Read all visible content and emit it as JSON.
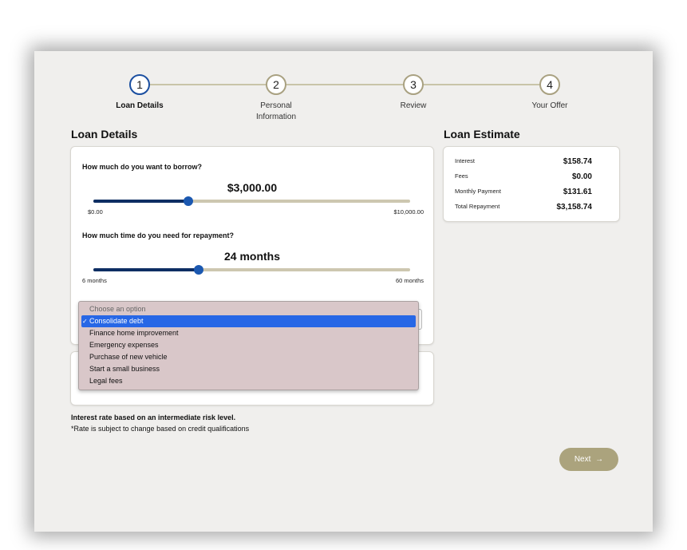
{
  "stepper": {
    "steps": [
      {
        "number": "1",
        "label": "Loan Details"
      },
      {
        "number": "2",
        "label": "Personal",
        "label2": "Information"
      },
      {
        "number": "3",
        "label": "Review"
      },
      {
        "number": "4",
        "label": "Your Offer"
      }
    ],
    "active_step": 1
  },
  "loan_details": {
    "heading": "Loan Details",
    "amount": {
      "question": "How much do you want to borrow?",
      "value": "$3,000.00",
      "min_label": "$0.00",
      "max_label": "$10,000.00",
      "fraction": 0.3
    },
    "term": {
      "question": "How much time do you need for repayment?",
      "value": "24 months",
      "min_label": "6 months",
      "max_label": "60 months",
      "fraction": 0.333
    },
    "purpose_dropdown": {
      "options": [
        "Choose an option",
        "Consolidate debt",
        "Finance home improvement",
        "Emergency expenses",
        "Purchase of new vehicle",
        "Start a small business",
        "Legal fees"
      ],
      "selected": "Consolidate debt",
      "check": "✓"
    }
  },
  "estimate": {
    "heading": "Loan Estimate",
    "rows": [
      {
        "label": "Interest",
        "value": "$158.74"
      },
      {
        "label": "Fees",
        "value": "$0.00"
      },
      {
        "label": "Monthly Payment",
        "value": "$131.61"
      },
      {
        "label": "Total Repayment",
        "value": "$3,158.74"
      }
    ]
  },
  "notes": {
    "rate_note": "Interest rate based on an intermediate risk level.",
    "rate_disclaimer": "*Rate is subject to change based on credit qualifications"
  },
  "next_button": {
    "label": "Next",
    "icon": "arrow-right-icon",
    "glyph": "→"
  },
  "colors": {
    "accent": "#aba37d",
    "primary": "#1b58b0",
    "dark_fill": "#0e2e63",
    "track": "#cdc7b0"
  }
}
